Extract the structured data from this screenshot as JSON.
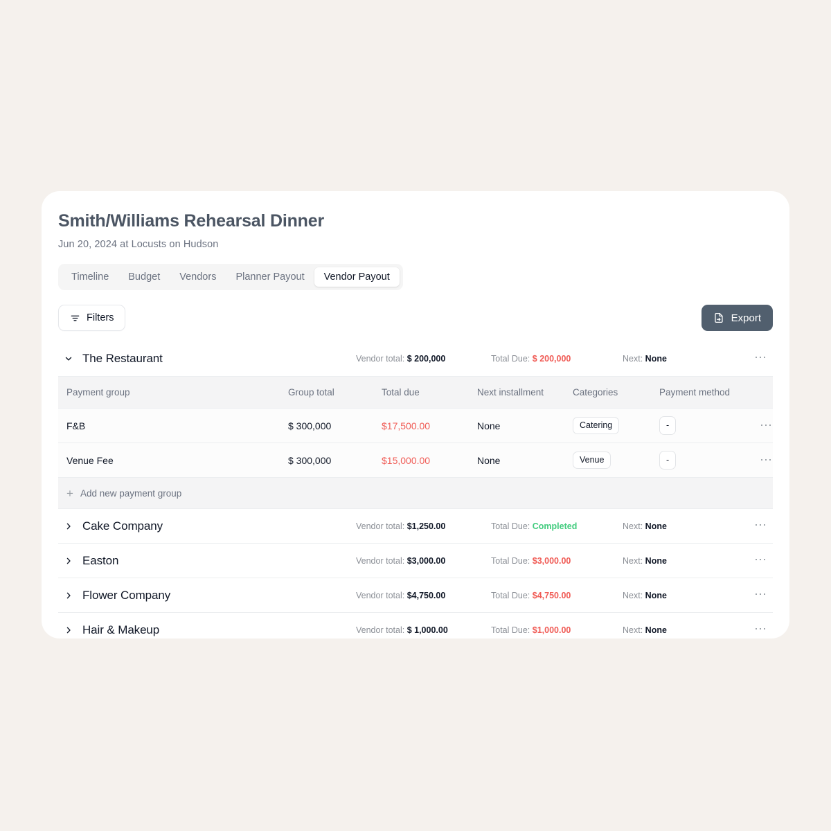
{
  "page": {
    "background_color": "#f5f1ed",
    "card_color": "#ffffff"
  },
  "header": {
    "title": "Smith/Williams Rehearsal Dinner",
    "subtitle": "Jun 20, 2024 at Locusts on Hudson"
  },
  "tabs": [
    {
      "label": "Timeline",
      "active": false
    },
    {
      "label": "Budget",
      "active": false
    },
    {
      "label": "Vendors",
      "active": false
    },
    {
      "label": "Planner Payout",
      "active": false
    },
    {
      "label": "Vendor Payout",
      "active": true
    }
  ],
  "toolbar": {
    "filters_label": "Filters",
    "filters_icon": "filter-icon",
    "export_label": "Export",
    "export_icon": "file-export-icon",
    "export_bg": "#515f6e"
  },
  "labels": {
    "vendor_total": "Vendor total:",
    "total_due": "Total Due:",
    "next": "Next:",
    "menu_icon": "ellipsis-icon",
    "add_group": "Add new payment group",
    "add_icon": "plus-icon"
  },
  "colors": {
    "due_red": "#f05b55",
    "completed_green": "#42cc7e",
    "muted": "#8b8f96"
  },
  "table_columns": [
    "Payment group",
    "Group total",
    "Total due",
    "Next installment",
    "Categories",
    "Payment method"
  ],
  "vendors": [
    {
      "name": "The Restaurant",
      "expanded": true,
      "chevron": "chevron-down-icon",
      "vendor_total": "$ 200,000",
      "total_due": "$ 200,000",
      "total_due_state": "due",
      "next": "None",
      "rows": [
        {
          "payment_group": "F&B",
          "group_total": "$ 300,000",
          "total_due": "$17,500.00",
          "next_installment": "None",
          "category": "Catering",
          "payment_method": "-"
        },
        {
          "payment_group": "Venue Fee",
          "group_total": "$ 300,000",
          "total_due": "$15,000.00",
          "next_installment": "None",
          "category": "Venue",
          "payment_method": "-"
        }
      ]
    },
    {
      "name": "Cake Company",
      "expanded": false,
      "chevron": "chevron-right-icon",
      "vendor_total": "$1,250.00",
      "total_due": "Completed",
      "total_due_state": "completed",
      "next": "None",
      "rows": []
    },
    {
      "name": "Easton",
      "expanded": false,
      "chevron": "chevron-right-icon",
      "vendor_total": "$3,000.00",
      "total_due": "$3,000.00",
      "total_due_state": "due",
      "next": "None",
      "rows": []
    },
    {
      "name": "Flower Company",
      "expanded": false,
      "chevron": "chevron-right-icon",
      "vendor_total": "$4,750.00",
      "total_due": "$4,750.00",
      "total_due_state": "due",
      "next": "None",
      "rows": []
    },
    {
      "name": "Hair & Makeup",
      "expanded": false,
      "chevron": "chevron-right-icon",
      "vendor_total": "$ 1,000.00",
      "total_due": "$1,000.00",
      "total_due_state": "due",
      "next": "None",
      "rows": []
    }
  ]
}
